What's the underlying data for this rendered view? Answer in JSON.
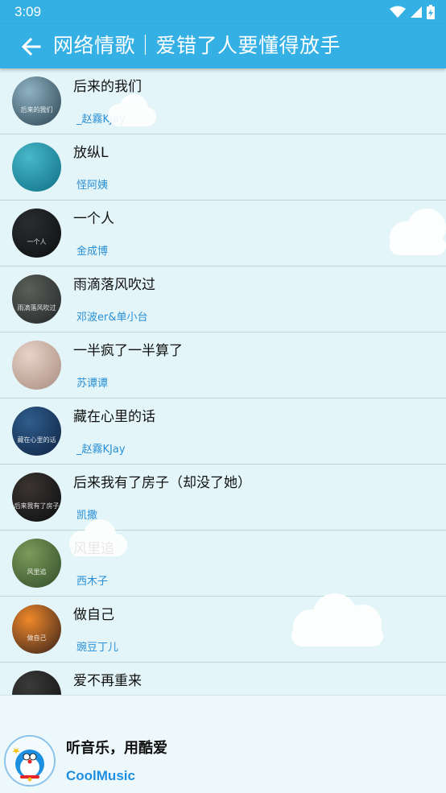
{
  "status_bar": {
    "time": "3:09",
    "icons": [
      "wifi-icon",
      "signal-icon",
      "battery-charging-icon"
    ]
  },
  "header": {
    "back_icon": "arrow-left-icon",
    "title": "网络情歌｜爱错了人要懂得放手"
  },
  "songs": [
    {
      "title": "后来的我们",
      "artist": "_赵霧KJay",
      "cover_text": "后来的我们",
      "cover_colors": [
        "#8fb3c4",
        "#2b4350"
      ]
    },
    {
      "title": "放纵L",
      "artist": "怪阿姨",
      "cover_text": "",
      "cover_colors": [
        "#48b8c9",
        "#0f6f86"
      ]
    },
    {
      "title": "一个人",
      "artist": "金成博",
      "cover_text": "一个人",
      "cover_colors": [
        "#2a2d30",
        "#0d0f10"
      ]
    },
    {
      "title": "雨滴落风吹过",
      "artist": "邓波er&单小台",
      "cover_text": "雨滴落风吹过",
      "cover_colors": [
        "#5a5f58",
        "#23272a"
      ]
    },
    {
      "title": "一半疯了一半算了",
      "artist": "苏谭谭",
      "cover_text": "",
      "cover_colors": [
        "#e8d2c8",
        "#a88c80"
      ]
    },
    {
      "title": "藏在心里的话",
      "artist": "_赵霧KJay",
      "cover_text": "藏在心里的话",
      "cover_colors": [
        "#2f5d8c",
        "#0f2343"
      ]
    },
    {
      "title": "后来我有了房子（却没了她）",
      "artist": "凯撒",
      "cover_text": "后来我有了房子",
      "cover_colors": [
        "#3b3531",
        "#0b0d10"
      ]
    },
    {
      "title": "风里追",
      "artist": "西木子",
      "cover_text": "风里追",
      "cover_colors": [
        "#7c9b5b",
        "#2f4d28"
      ]
    },
    {
      "title": "做自己",
      "artist": "豌豆丁儿",
      "cover_text": "做自己",
      "cover_colors": [
        "#f0892a",
        "#35201a"
      ]
    },
    {
      "title": "爱不再重来",
      "artist": "",
      "cover_text": "",
      "cover_colors": [
        "#3a3a3a",
        "#121212"
      ]
    }
  ],
  "bottom_bar": {
    "avatar_icon": "doraemon-avatar-icon",
    "slogan": "听音乐，用酷爱",
    "brand": "CoolMusic"
  },
  "colors": {
    "primary": "#35b0e5",
    "background": "#e3f5f8",
    "artist_text": "#2a8fd6",
    "brand_text": "#1e8ee0"
  }
}
